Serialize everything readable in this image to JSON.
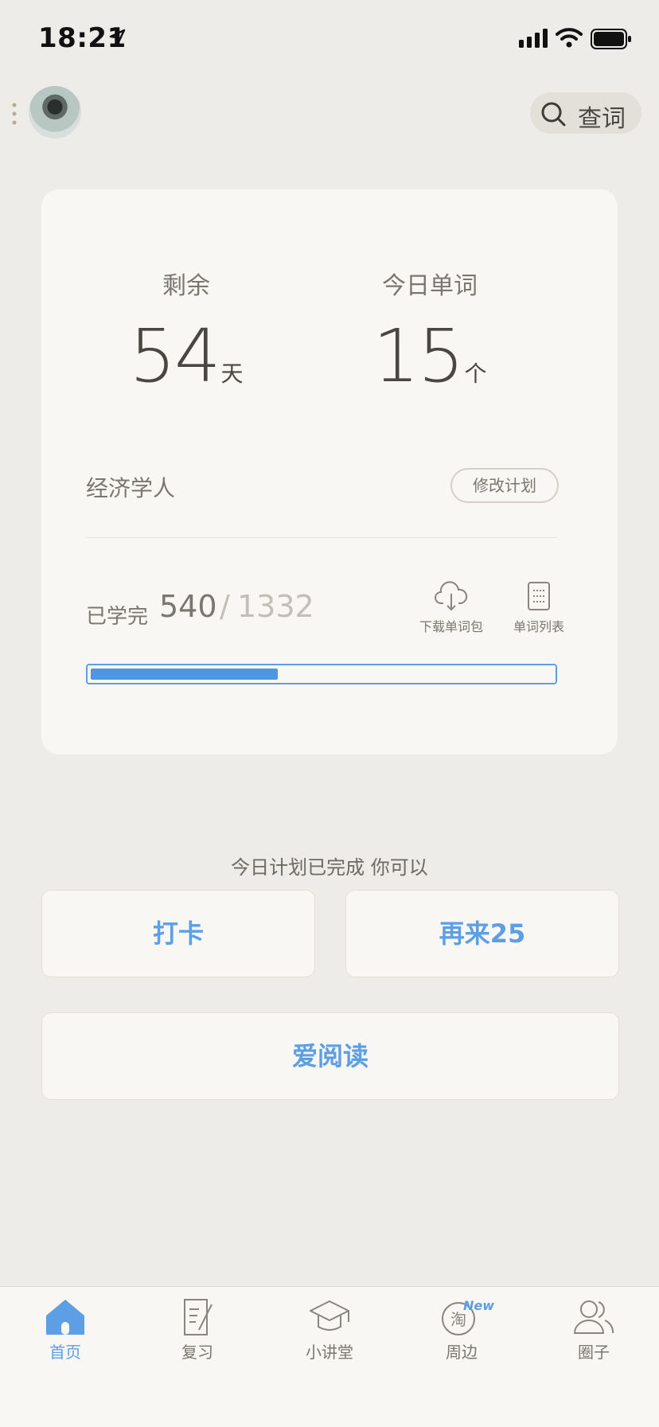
{
  "status_bar": {
    "time": "18:21"
  },
  "header": {
    "search_label": "查词"
  },
  "plan": {
    "remaining_label": "剩余",
    "remaining_value": "54",
    "remaining_unit": "天",
    "today_label": "今日单词",
    "today_value": "15",
    "today_unit": "个",
    "book_name": "经济学人",
    "modify_label": "修改计划",
    "learned_label": "已学完",
    "learned_count": "540",
    "separator": "/",
    "total_count": "1332",
    "progress_fraction": 0.405,
    "tools": [
      {
        "label": "下载单词包",
        "icon": "cloud-download-icon"
      },
      {
        "label": "单词列表",
        "icon": "word-list-icon"
      }
    ]
  },
  "completion": {
    "message": "今日计划已完成 你可以",
    "checkin_label": "打卡",
    "again_label": "再来25",
    "read_label": "爱阅读"
  },
  "tabs": [
    {
      "label": "首页",
      "icon": "home-icon",
      "active": true
    },
    {
      "label": "复习",
      "icon": "review-icon"
    },
    {
      "label": "小讲堂",
      "icon": "graduation-cap-icon"
    },
    {
      "label": "周边",
      "icon": "taobao-icon",
      "badge": "New"
    },
    {
      "label": "圈子",
      "icon": "people-icon"
    }
  ],
  "colors": {
    "accent": "#5C9FE4",
    "background": "#EEECE8",
    "card": "#F8F7F3"
  }
}
